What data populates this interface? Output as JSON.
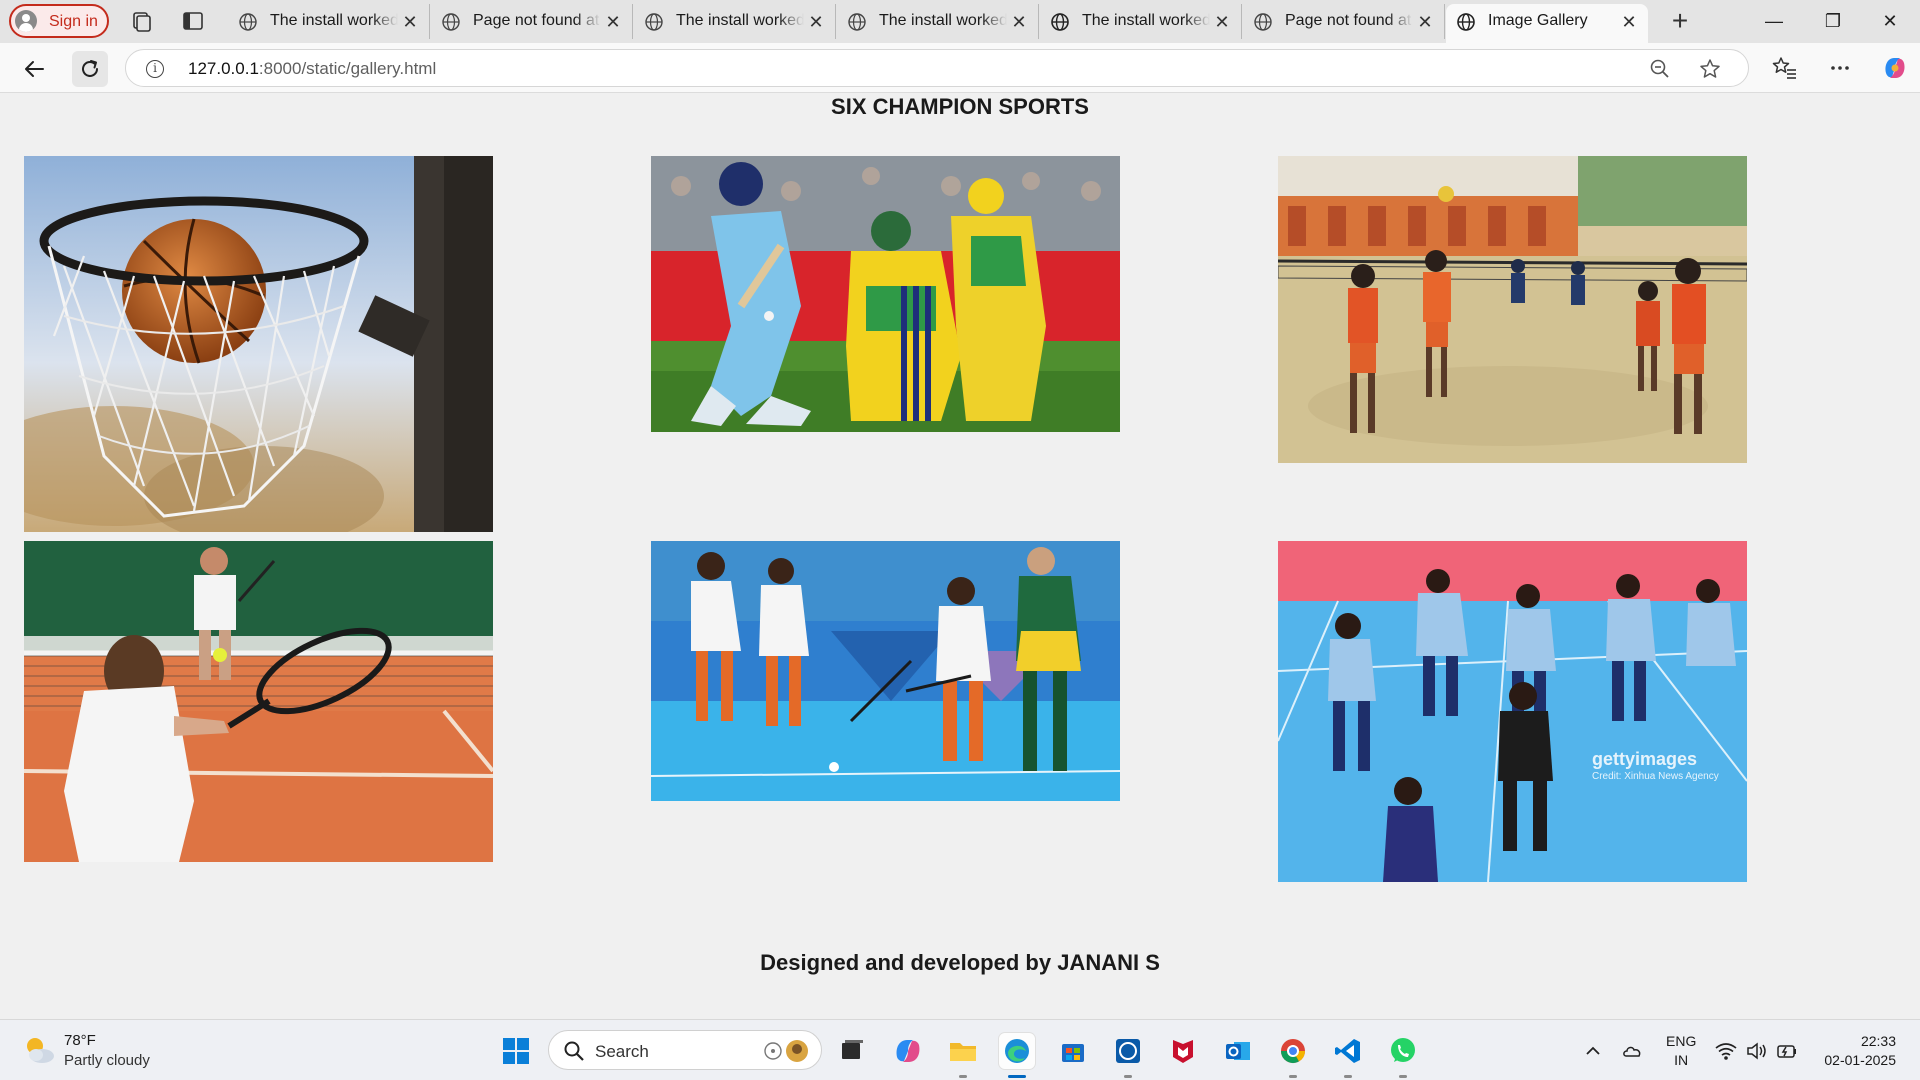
{
  "browser": {
    "sign_in_label": "Sign in",
    "tabs": [
      {
        "title": "The install worked successfully!"
      },
      {
        "title": "Page not found at /"
      },
      {
        "title": "The install worked successfully!"
      },
      {
        "title": "The install worked successfully!"
      },
      {
        "title": "The install worked successfully!"
      },
      {
        "title": "Page not found at /"
      },
      {
        "title": "Image Gallery"
      }
    ],
    "active_tab_index": 6,
    "url_host": "127.0.0.1",
    "url_path": ":8000/static/gallery.html"
  },
  "page": {
    "heading": "SIX CHAMPION SPORTS",
    "images": [
      {
        "subject": "basketball"
      },
      {
        "subject": "cricket"
      },
      {
        "subject": "volleyball"
      },
      {
        "subject": "tennis"
      },
      {
        "subject": "hockey"
      },
      {
        "subject": "kabaddi",
        "watermark": "gettyimages",
        "credit": "Credit: Xinhua News Agency"
      }
    ],
    "footer": "Designed and developed by JANANI S"
  },
  "taskbar": {
    "weather_temp": "78°F",
    "weather_desc": "Partly cloudy",
    "search_label": "Search",
    "lang_line1": "ENG",
    "lang_line2": "IN",
    "time": "22:33",
    "date": "02-01-2025",
    "apps": [
      "task-view-icon",
      "copilot-icon",
      "file-explorer-icon",
      "edge-icon",
      "store-icon",
      "dell-icon",
      "mcafee-icon",
      "outlook-icon",
      "chrome-icon",
      "vscode-icon",
      "whatsapp-icon"
    ]
  },
  "colors": {
    "accent": "#0067c0",
    "sign_in": "#c42b1c",
    "page_bg": "#f0f0f0"
  }
}
